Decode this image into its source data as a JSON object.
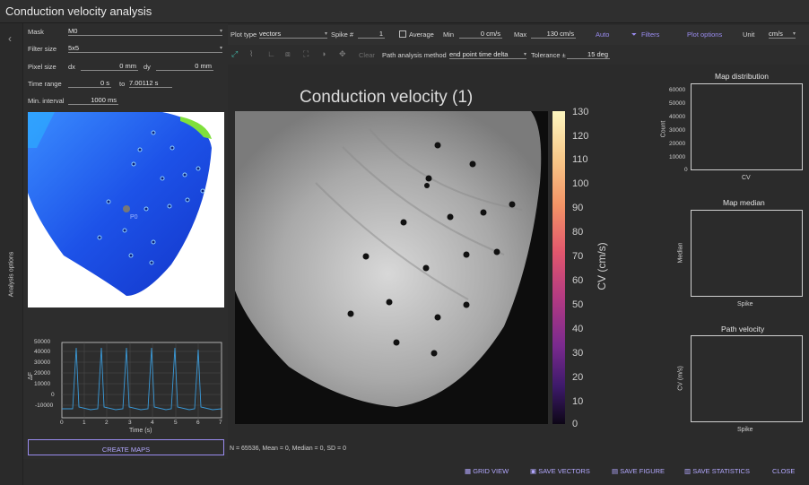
{
  "window": {
    "title": "Conduction velocity analysis"
  },
  "sidebar": {
    "collapse_icon": "chevron-left",
    "vertical_label": "Analysis options"
  },
  "analysis": {
    "mask_label": "Mask",
    "mask_value": "M0",
    "filter_label": "Filter size",
    "filter_value": "5x5",
    "pixel_label": "Pixel size",
    "dx_label": "dx",
    "dx_value": "0 mm",
    "dy_label": "dy",
    "dy_value": "0 mm",
    "time_label": "Time range",
    "time_from": "0 s",
    "time_to_label": "to",
    "time_to": "7.00112 s",
    "interval_label": "Min. interval",
    "interval_value": "1000 ms",
    "roi_label": "P0",
    "create_maps": "CREATE MAPS"
  },
  "trace": {
    "ylabel": "ΔF",
    "xlabel": "Time (s)",
    "yticks": [
      "50000",
      "40000",
      "30000",
      "20000",
      "10000",
      "0",
      "-10000"
    ],
    "xticks": [
      "0",
      "1",
      "2",
      "3",
      "4",
      "5",
      "6",
      "7"
    ]
  },
  "toolbar": {
    "plot_type_label": "Plot type",
    "plot_type_value": "vectors",
    "spike_label": "Spike #",
    "spike_value": "1",
    "average_label": "Average",
    "min_label": "Min",
    "min_value": "0 cm/s",
    "max_label": "Max",
    "max_value": "130 cm/s",
    "auto_label": "Auto",
    "filters_label": "Filters",
    "plot_options_label": "Plot options",
    "unit_label": "Unit",
    "unit_value": "cm/s",
    "clear_label": "Clear",
    "path_method_label": "Path analysis method",
    "path_method_value": "end point time delta",
    "tolerance_label": "Tolerance ±",
    "tolerance_value": "15 deg"
  },
  "map": {
    "title": "Conduction velocity (1)",
    "colorbar_label": "CV (cm/s)",
    "colorbar_ticks": [
      "130",
      "120",
      "110",
      "100",
      "90",
      "80",
      "70",
      "60",
      "50",
      "40",
      "30",
      "20",
      "10",
      "0"
    ],
    "stats": "N = 65536, Mean = 0, Median = 0, SD = 0"
  },
  "side_charts": {
    "distribution": {
      "title": "Map distribution",
      "ylabel": "Count",
      "xlabel": "CV",
      "yticks": [
        "60000",
        "50000",
        "40000",
        "30000",
        "20000",
        "10000",
        "0"
      ]
    },
    "median": {
      "title": "Map median",
      "ylabel": "Median",
      "xlabel": "Spike"
    },
    "path": {
      "title": "Path velocity",
      "ylabel": "CV (m/s)",
      "xlabel": "Spike"
    }
  },
  "footer": {
    "grid_view": "GRID VIEW",
    "save_vectors": "SAVE VECTORS",
    "save_figure": "SAVE FIGURE",
    "save_statistics": "SAVE STATISTICS",
    "close": "CLOSE"
  },
  "colors": {
    "accent": "#9a8cf0",
    "teal": "#41b6a6",
    "background": "#2b2b2b"
  }
}
